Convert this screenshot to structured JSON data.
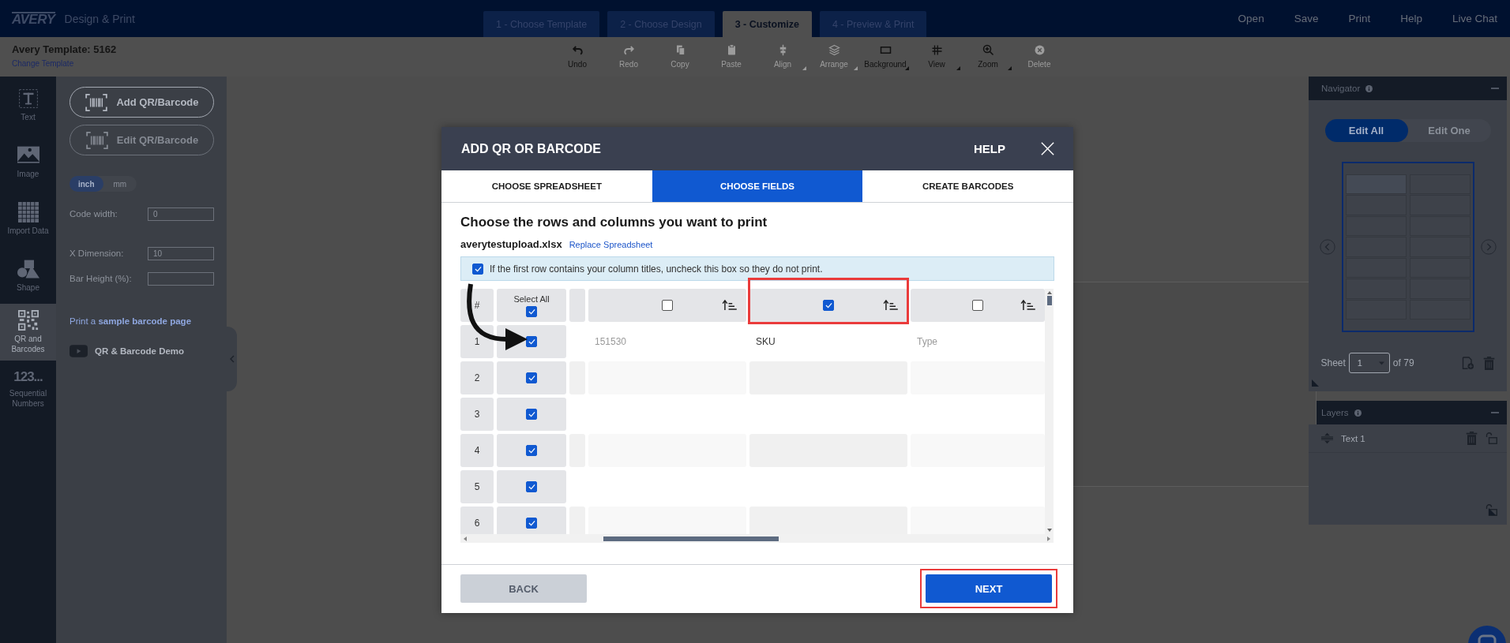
{
  "app": {
    "brand": "AVERY",
    "product": "Design & Print"
  },
  "steps": [
    {
      "label": "1 - Choose Template",
      "selected": false
    },
    {
      "label": "2 - Choose Design",
      "selected": false
    },
    {
      "label": "3 - Customize",
      "selected": true
    },
    {
      "label": "4 - Preview & Print",
      "selected": false
    }
  ],
  "nav": [
    "Open",
    "Save",
    "Print",
    "Help",
    "Live Chat"
  ],
  "template": {
    "title": "Avery Template: 5162",
    "link": "Change Template"
  },
  "toolbar": [
    {
      "kind": "undo",
      "label": "Undo",
      "disabled": false,
      "menu": false
    },
    {
      "kind": "redo",
      "label": "Redo",
      "disabled": true,
      "menu": false
    },
    {
      "kind": "copy",
      "label": "Copy",
      "disabled": true,
      "menu": false
    },
    {
      "kind": "paste",
      "label": "Paste",
      "disabled": true,
      "menu": false
    },
    {
      "kind": "align",
      "label": "Align",
      "disabled": true,
      "menu": true
    },
    {
      "kind": "arrange",
      "label": "Arrange",
      "disabled": true,
      "menu": true
    },
    {
      "kind": "background",
      "label": "Background",
      "disabled": false,
      "menu": true
    },
    {
      "kind": "view",
      "label": "View",
      "disabled": false,
      "menu": true
    },
    {
      "kind": "zoom",
      "label": "Zoom",
      "disabled": false,
      "menu": true
    },
    {
      "kind": "delete",
      "label": "Delete",
      "disabled": true,
      "menu": false
    }
  ],
  "tool_rail": [
    {
      "kind": "text",
      "label": "Text",
      "selected": false
    },
    {
      "kind": "image",
      "label": "Image",
      "selected": false
    },
    {
      "kind": "data",
      "label": "Import Data",
      "selected": false
    },
    {
      "kind": "shape",
      "label": "Shape",
      "selected": false
    },
    {
      "kind": "qr",
      "label": "QR and Barcodes",
      "selected": true
    },
    {
      "kind": "numbers",
      "glyph": "123...",
      "label": "Sequential Numbers",
      "selected": false
    }
  ],
  "barcode_panel": {
    "buttons": [
      {
        "label": "Add QR/Barcode",
        "disabled": false
      },
      {
        "label": "Edit QR/Barcode",
        "disabled": true
      }
    ],
    "units": [
      {
        "label": "inch",
        "selected": true
      },
      {
        "label": "mm",
        "selected": false
      }
    ],
    "fields": [
      {
        "label": "Code width:",
        "value": "0"
      },
      {
        "label": "X Dimension:",
        "value": "10"
      },
      {
        "label": "Bar Height (%):"
      }
    ],
    "sample_link": "Print a **sample barcode page**",
    "demo": "QR & Barcode Demo"
  },
  "navigator": {
    "title": "Navigator",
    "modes": [
      {
        "label": "Edit All",
        "selected": true
      },
      {
        "label": "Edit One",
        "selected": false
      }
    ],
    "sheet_label": "Sheet",
    "sheet_value": "1",
    "sheet_total": "of 79"
  },
  "layers": {
    "title": "Layers",
    "items": [
      {
        "label": "Text 1"
      }
    ]
  },
  "dialog": {
    "title": "ADD QR OR BARCODE",
    "help": "HELP",
    "tabs": [
      {
        "label": "CHOOSE SPREADSHEET",
        "selected": false
      },
      {
        "label": "CHOOSE FIELDS",
        "selected": true
      },
      {
        "label": "CREATE BARCODES",
        "selected": false
      }
    ],
    "heading": "Choose the rows and columns you want to print",
    "file": "averytestupload.xlsx",
    "replace_link": "Replace Spreadsheet",
    "header_row": {
      "checked": true,
      "text": "If the first row contains your column titles, uncheck this box so they do not print."
    },
    "grid": {
      "index_header": "#",
      "select_all": {
        "label": "Select All",
        "checked": true
      },
      "columns": [
        {
          "checked": false,
          "highlighted": false
        },
        {
          "checked": true,
          "highlighted": true
        },
        {
          "checked": false,
          "highlighted": false
        }
      ],
      "rows": [
        {
          "number": "1",
          "checked": true,
          "cells": [
            "151530",
            "SKU",
            "Type"
          ]
        },
        {
          "number": "2",
          "checked": true
        },
        {
          "number": "3",
          "checked": true
        },
        {
          "number": "4",
          "checked": true
        },
        {
          "number": "5",
          "checked": true
        },
        {
          "number": "6",
          "checked": true
        }
      ]
    },
    "back": "BACK",
    "next": {
      "label": "NEXT",
      "highlighted": true
    }
  }
}
